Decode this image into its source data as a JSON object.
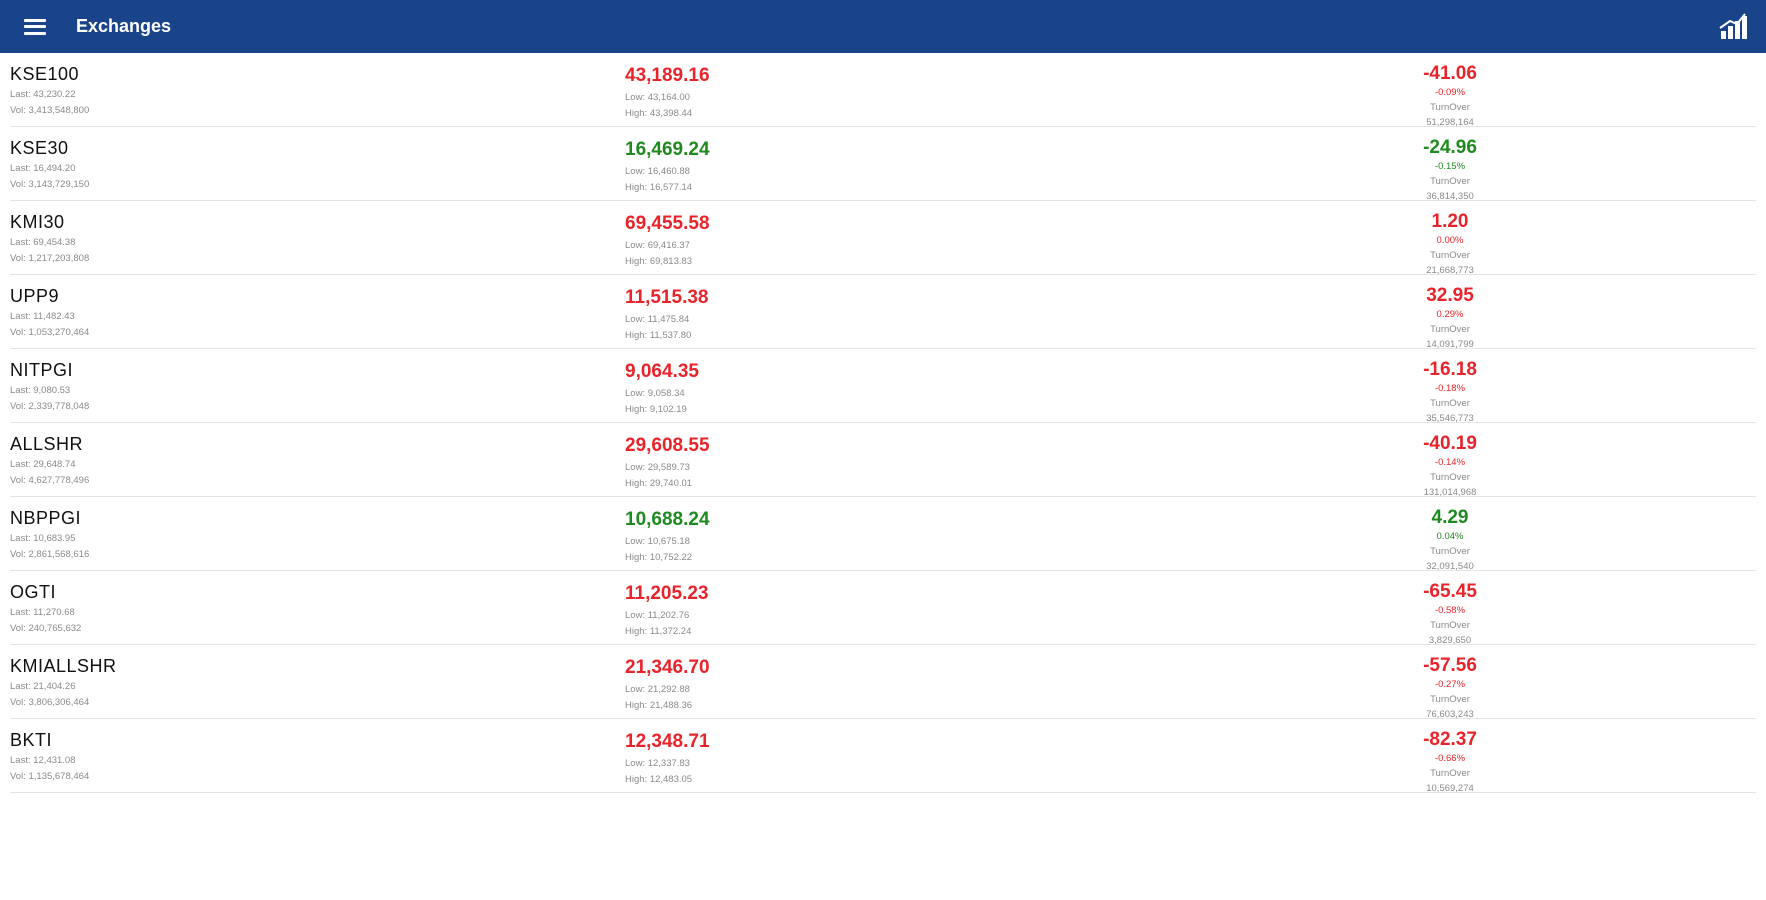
{
  "header": {
    "title": "Exchanges",
    "menu_icon": "hamburger-menu-icon",
    "action_icon": "bar-chart-icon",
    "bg_color": "#1a4489"
  },
  "colors": {
    "down": "#e8242a",
    "up": "#1f8a20"
  },
  "indices": [
    {
      "name": "KSE100",
      "last": "Last: 43,230.22",
      "vol": "Vol: 3,413,548,800",
      "value": "43,189.16",
      "low": "Low: 43,164.00",
      "high": "High: 43,398.44",
      "change": "-41.06",
      "percent": "-0.09%",
      "turnover_label": "TurnOver",
      "turnover": "51,298,164",
      "dir": "down"
    },
    {
      "name": "KSE30",
      "last": "Last: 16,494.20",
      "vol": "Vol: 3,143,729,150",
      "value": "16,469.24",
      "low": "Low: 16,460.88",
      "high": "High: 16,577.14",
      "change": "-24.96",
      "percent": "-0.15%",
      "turnover_label": "TurnOver",
      "turnover": "36,814,350",
      "dir": "up"
    },
    {
      "name": "KMI30",
      "last": "Last: 69,454.38",
      "vol": "Vol: 1,217,203,808",
      "value": "69,455.58",
      "low": "Low: 69,416.37",
      "high": "High: 69,813.83",
      "change": "1.20",
      "percent": "0.00%",
      "turnover_label": "TurnOver",
      "turnover": "21,668,773",
      "dir": "down"
    },
    {
      "name": "UPP9",
      "last": "Last: 11,482.43",
      "vol": "Vol: 1,053,270,464",
      "value": "11,515.38",
      "low": "Low: 11,475.84",
      "high": "High: 11,537.80",
      "change": "32.95",
      "percent": "0.29%",
      "turnover_label": "TurnOver",
      "turnover": "14,091,799",
      "dir": "down"
    },
    {
      "name": "NITPGI",
      "last": "Last: 9,080.53",
      "vol": "Vol: 2,339,778,048",
      "value": "9,064.35",
      "low": "Low: 9,058.34",
      "high": "High: 9,102.19",
      "change": "-16.18",
      "percent": "-0.18%",
      "turnover_label": "TurnOver",
      "turnover": "35,546,773",
      "dir": "down"
    },
    {
      "name": "ALLSHR",
      "last": "Last: 29,648.74",
      "vol": "Vol: 4,627,778,496",
      "value": "29,608.55",
      "low": "Low: 29,589.73",
      "high": "High: 29,740.01",
      "change": "-40.19",
      "percent": "-0.14%",
      "turnover_label": "TurnOver",
      "turnover": "131,014,968",
      "dir": "down"
    },
    {
      "name": "NBPPGI",
      "last": "Last: 10,683.95",
      "vol": "Vol: 2,861,568,616",
      "value": "10,688.24",
      "low": "Low: 10,675.18",
      "high": "High: 10,752.22",
      "change": "4.29",
      "percent": "0.04%",
      "turnover_label": "TurnOver",
      "turnover": "32,091,540",
      "dir": "up"
    },
    {
      "name": "OGTI",
      "last": "Last: 11,270.68",
      "vol": "Vol: 240,765,632",
      "value": "11,205.23",
      "low": "Low: 11,202.76",
      "high": "High: 11,372.24",
      "change": "-65.45",
      "percent": "-0.58%",
      "turnover_label": "TurnOver",
      "turnover": "3,829,650",
      "dir": "down"
    },
    {
      "name": "KMIALLSHR",
      "last": "Last: 21,404.26",
      "vol": "Vol: 3,806,306,464",
      "value": "21,346.70",
      "low": "Low: 21,292.88",
      "high": "High: 21,488.36",
      "change": "-57.56",
      "percent": "-0.27%",
      "turnover_label": "TurnOver",
      "turnover": "76,603,243",
      "dir": "down"
    },
    {
      "name": "BKTI",
      "last": "Last: 12,431.08",
      "vol": "Vol: 1,135,678,464",
      "value": "12,348.71",
      "low": "Low: 12,337.83",
      "high": "High: 12,483.05",
      "change": "-82.37",
      "percent": "-0.66%",
      "turnover_label": "TurnOver",
      "turnover": "10,569,274",
      "dir": "down"
    }
  ]
}
